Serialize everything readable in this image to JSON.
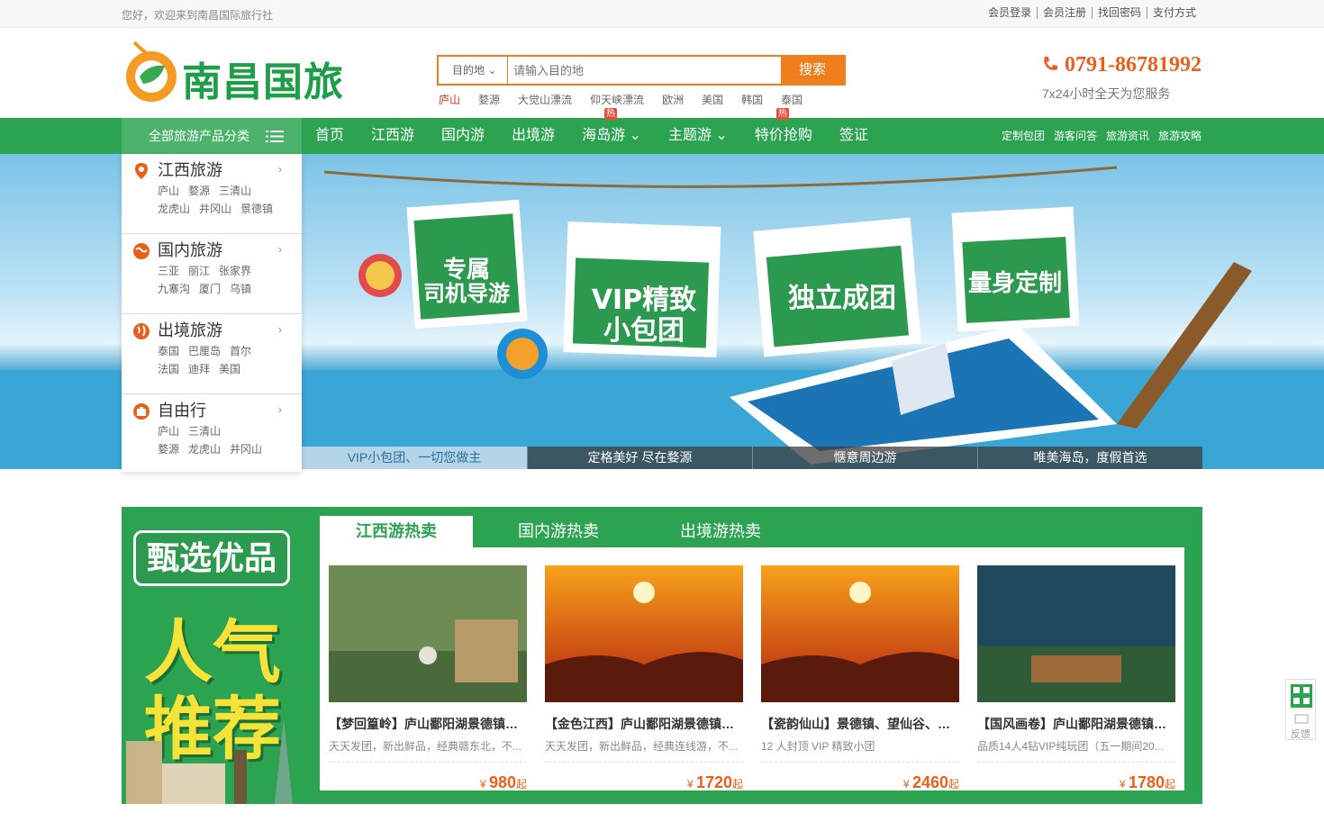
{
  "topbar": {
    "welcome": "您好，欢迎来到南昌国际旅行社",
    "links": [
      "会员登录",
      "会员注册",
      "找回密码",
      "支付方式"
    ]
  },
  "logo": {
    "name": "南昌国旅"
  },
  "search": {
    "select": "目的地",
    "placeholder": "请输入目的地",
    "button": "搜索",
    "hotwords": [
      "庐山",
      "婺源",
      "大觉山漂流",
      "仰天峡漂流",
      "欧洲",
      "美国",
      "韩国",
      "泰国"
    ]
  },
  "contact": {
    "phone": "0791-86781992",
    "service": "7x24小时全天为您服务"
  },
  "nav": {
    "category": "全部旅游产品分类",
    "items": [
      {
        "label": "首页"
      },
      {
        "label": "江西游"
      },
      {
        "label": "国内游"
      },
      {
        "label": "出境游"
      },
      {
        "label": "海岛游",
        "hot": "热",
        "dropdown": true
      },
      {
        "label": "主题游",
        "dropdown": true
      },
      {
        "label": "特价抢购",
        "hot": "热"
      },
      {
        "label": "签证"
      }
    ],
    "right": [
      "定制包团",
      "游客问答",
      "旅游资讯",
      "旅游攻略"
    ]
  },
  "categories": [
    {
      "title": "江西旅游",
      "rows": [
        [
          "庐山",
          "婺源",
          "三清山"
        ],
        [
          "龙虎山",
          "井冈山",
          "景德镇"
        ]
      ]
    },
    {
      "title": "国内旅游",
      "rows": [
        [
          "三亚",
          "丽江",
          "张家界"
        ],
        [
          "九寨沟",
          "厦门",
          "乌镇"
        ]
      ]
    },
    {
      "title": "出境旅游",
      "rows": [
        [
          "泰国",
          "巴厘岛",
          "首尔"
        ],
        [
          "法国",
          "迪拜",
          "美国"
        ]
      ]
    },
    {
      "title": "自由行",
      "rows": [
        [
          "庐山",
          "三清山"
        ],
        [
          "婺源",
          "龙虎山",
          "井冈山"
        ]
      ]
    }
  ],
  "banner": {
    "cards": [
      "专属\n司机导游",
      "VIP精致\n小包团",
      "独立成团",
      "量身定制"
    ],
    "tabs": [
      "VIP小包团、一切您做主",
      "定格美好 尽在婺源",
      "惬意周边游",
      "唯美海岛，度假首选"
    ]
  },
  "hot": {
    "badge1": "甄选优品",
    "badge2": "人气",
    "badge3": "推荐",
    "tabs": [
      "江西游热卖",
      "国内游热卖",
      "出境游热卖"
    ],
    "products": [
      {
        "title": "【梦回篁岭】庐山鄱阳湖景德镇婺源",
        "desc": "天天发团，新出鲜品，经典赣东北，不...",
        "price": "980",
        "unit": "起",
        "currency": "¥"
      },
      {
        "title": "【金色江西】庐山鄱阳湖景德镇婺源",
        "desc": "天天发团，新出鲜品，经典连线游，不...",
        "price": "1720",
        "unit": "起",
        "currency": "¥"
      },
      {
        "title": "【瓷韵仙山】景德镇、望仙谷、三清山",
        "desc": "12 人封顶 VIP 精致小团",
        "price": "2460",
        "unit": "起",
        "currency": "¥"
      },
      {
        "title": "【国风画卷】庐山鄱阳湖景德镇婺源",
        "desc": "品质14人4钻VIP纯玩团（五一期间20...",
        "price": "1780",
        "unit": "起",
        "currency": "¥"
      }
    ]
  },
  "side": {
    "feedback": "反馈"
  },
  "colors": {
    "green": "#2ba351",
    "orange": "#f07e1b"
  }
}
